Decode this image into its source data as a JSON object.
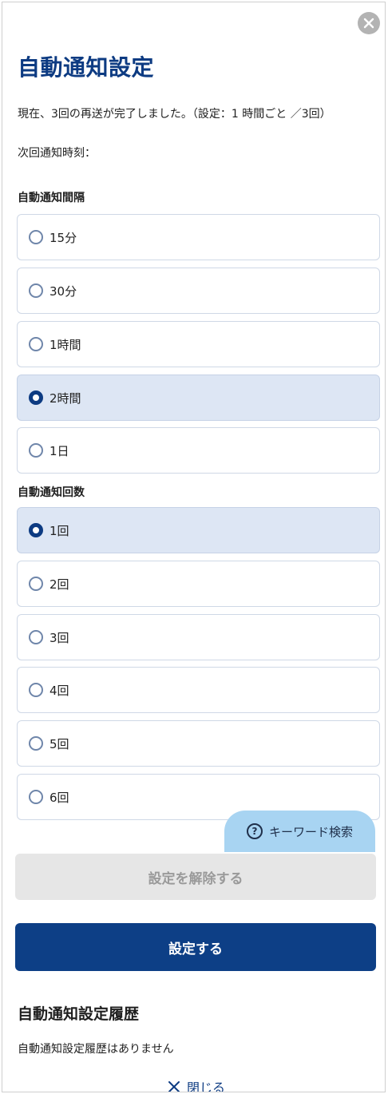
{
  "title": "自動通知設定",
  "status_line1": "現在、3回の再送が完了しました。（設定：1 時間ごと ／3回）",
  "status_line2": "次回通知時刻：",
  "interval": {
    "label": "自動通知間隔",
    "options": [
      {
        "label": "15分",
        "selected": false
      },
      {
        "label": "30分",
        "selected": false
      },
      {
        "label": "1時間",
        "selected": false
      },
      {
        "label": "2時間",
        "selected": true
      },
      {
        "label": "1日",
        "selected": false
      }
    ]
  },
  "count": {
    "label": "自動通知回数",
    "options": [
      {
        "label": "1回",
        "selected": true
      },
      {
        "label": "2回",
        "selected": false
      },
      {
        "label": "3回",
        "selected": false
      },
      {
        "label": "4回",
        "selected": false
      },
      {
        "label": "5回",
        "selected": false
      },
      {
        "label": "6回",
        "selected": false
      }
    ]
  },
  "keyword_search": {
    "label": "キーワード検索",
    "icon": "question-circle-icon"
  },
  "buttons": {
    "release": "設定を解除する",
    "submit": "設定する",
    "close": "閉じる"
  },
  "history": {
    "title": "自動通知設定履歴",
    "empty": "自動通知設定履歴はありません"
  },
  "colors": {
    "primary": "#0d3f86",
    "selected_bg": "#dde6f4",
    "keyword_bg": "#a8d4f2",
    "disabled_bg": "#e6e6e6"
  }
}
